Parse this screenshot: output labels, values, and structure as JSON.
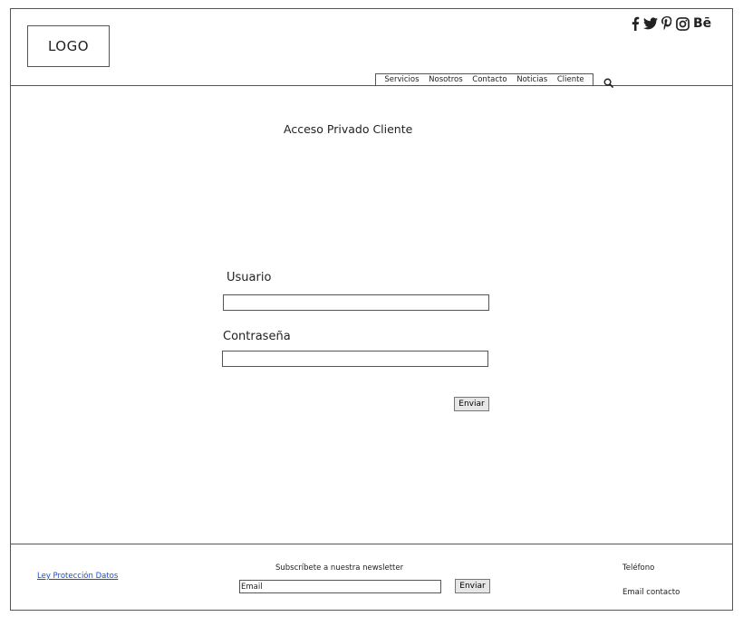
{
  "header": {
    "logo": "LOGO",
    "social_icons": [
      "facebook-icon",
      "twitter-icon",
      "pinterest-icon",
      "instagram-icon",
      "behance-icon"
    ],
    "behance_text": "Bē",
    "nav": [
      {
        "label": "Servicios"
      },
      {
        "label": "Nosotros"
      },
      {
        "label": "Contacto"
      },
      {
        "label": "Noticias"
      },
      {
        "label": "Cliente"
      }
    ]
  },
  "main": {
    "title": "Acceso Privado Cliente",
    "username_label": "Usuario",
    "username_value": "",
    "password_label": "Contraseña",
    "password_value": "",
    "submit_label": "Enviar"
  },
  "footer": {
    "privacy_link": "Ley Protección Datos",
    "newsletter_title": "Subscríbete a nuestra newsletter",
    "newsletter_placeholder": "Email",
    "newsletter_button": "Enviar",
    "phone": "Teléfono",
    "email": "Email contacto"
  },
  "colors": {
    "border": "#555555",
    "link": "#1a4fc4",
    "button_bg": "#e6e6e6"
  }
}
